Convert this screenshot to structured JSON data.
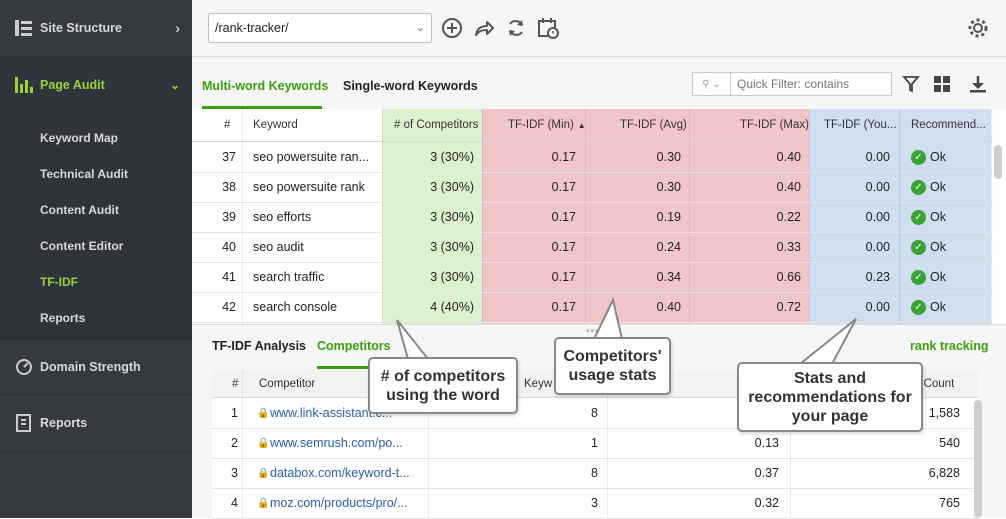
{
  "sidebar": {
    "site_structure": "Site Structure",
    "page_audit": "Page Audit",
    "sub_items": [
      "Keyword Map",
      "Technical Audit",
      "Content Audit",
      "Content Editor",
      "TF-IDF",
      "Reports"
    ],
    "domain_strength": "Domain Strength",
    "reports": "Reports"
  },
  "toolbar": {
    "url_value": "/rank-tracker/"
  },
  "tabs_top": {
    "multi": "Multi-word Keywords",
    "single": "Single-word Keywords",
    "filter_placeholder": "Quick Filter: contains"
  },
  "main_table": {
    "headers": {
      "num": "#",
      "keyword": "Keyword",
      "competitors": "# of Competitors",
      "min": "TF-IDF (Min)",
      "avg": "TF-IDF (Avg)",
      "max": "TF-IDF (Max)",
      "yours": "TF-IDF (You...",
      "rec": "Recommend..."
    },
    "rows": [
      {
        "n": "37",
        "kw": "seo powersuite ran...",
        "comp": "3 (30%)",
        "min": "0.17",
        "avg": "0.30",
        "max": "0.40",
        "you": "0.00",
        "rec": "Ok"
      },
      {
        "n": "38",
        "kw": "seo powersuite rank",
        "comp": "3 (30%)",
        "min": "0.17",
        "avg": "0.30",
        "max": "0.40",
        "you": "0.00",
        "rec": "Ok"
      },
      {
        "n": "39",
        "kw": "seo efforts",
        "comp": "3 (30%)",
        "min": "0.17",
        "avg": "0.19",
        "max": "0.22",
        "you": "0.00",
        "rec": "Ok"
      },
      {
        "n": "40",
        "kw": "seo audit",
        "comp": "3 (30%)",
        "min": "0.17",
        "avg": "0.24",
        "max": "0.33",
        "you": "0.00",
        "rec": "Ok"
      },
      {
        "n": "41",
        "kw": "search traffic",
        "comp": "3 (30%)",
        "min": "0.17",
        "avg": "0.34",
        "max": "0.66",
        "you": "0.23",
        "rec": "Ok"
      },
      {
        "n": "42",
        "kw": "search console",
        "comp": "4 (40%)",
        "min": "0.17",
        "avg": "0.40",
        "max": "0.72",
        "you": "0.00",
        "rec": "Ok"
      }
    ]
  },
  "tabs_bottom": {
    "analysis": "TF-IDF Analysis",
    "competitors": "Competitors",
    "right_label": "rank tracking"
  },
  "lower_table": {
    "headers": {
      "num": "#",
      "competitor": "Competitor",
      "keyword": "Keyw",
      "word_count": "d Count"
    },
    "rows": [
      {
        "n": "1",
        "url": "www.link-assistant.c...",
        "kw": "8",
        "tf": "",
        "wc": "1,583"
      },
      {
        "n": "2",
        "url": "www.semrush.com/po...",
        "kw": "1",
        "tf": "0.13",
        "wc": "540"
      },
      {
        "n": "3",
        "url": "databox.com/keyword-t...",
        "kw": "8",
        "tf": "0.37",
        "wc": "6,828"
      },
      {
        "n": "4",
        "url": "moz.com/products/pro/...",
        "kw": "3",
        "tf": "0.32",
        "wc": "765"
      }
    ]
  },
  "callouts": {
    "competitors": "# of competitors\nusing the word",
    "usage": "Competitors'\nusage stats",
    "recommend": "Stats and\nrecommendations for\nyour page"
  },
  "colors": {
    "green_col": "#dcf2cf",
    "red_col": "#f0c6c8",
    "blue_col": "#cfdff0",
    "accent": "#3a9f0a"
  }
}
